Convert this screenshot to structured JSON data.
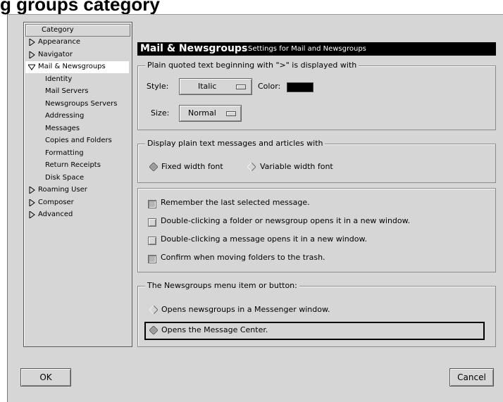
{
  "banner": {
    "text": "g                                                     groups category"
  },
  "tree": {
    "header": "Category",
    "items": [
      {
        "label": "Appearance",
        "level": 0,
        "expanded": false,
        "selected": false
      },
      {
        "label": "Navigator",
        "level": 0,
        "expanded": false,
        "selected": false
      },
      {
        "label": "Mail & Newsgroups",
        "level": 0,
        "expanded": true,
        "selected": true
      },
      {
        "label": "Identity",
        "level": 1,
        "selected": false
      },
      {
        "label": "Mail Servers",
        "level": 1,
        "selected": false
      },
      {
        "label": "Newsgroups Servers",
        "level": 1,
        "selected": false
      },
      {
        "label": "Addressing",
        "level": 1,
        "selected": false
      },
      {
        "label": "Messages",
        "level": 1,
        "selected": false
      },
      {
        "label": "Copies and Folders",
        "level": 1,
        "selected": false
      },
      {
        "label": "Formatting",
        "level": 1,
        "selected": false
      },
      {
        "label": "Return Receipts",
        "level": 1,
        "selected": false
      },
      {
        "label": "Disk Space",
        "level": 1,
        "selected": false
      },
      {
        "label": "Roaming User",
        "level": 0,
        "expanded": false,
        "selected": false
      },
      {
        "label": "Composer",
        "level": 0,
        "expanded": false,
        "selected": false
      },
      {
        "label": "Advanced",
        "level": 0,
        "expanded": false,
        "selected": false
      }
    ]
  },
  "section": {
    "title": "Mail & Newsgroups",
    "subtitle": "Settings for Mail and Newsgroups"
  },
  "quoted": {
    "legend": "Plain quoted text beginning with \">\" is displayed with",
    "style_label": "Style:",
    "style_value": "Italic",
    "color_label": "Color:",
    "color_value": "#000000",
    "size_label": "Size:",
    "size_value": "Normal"
  },
  "display": {
    "legend": "Display plain text messages and articles with",
    "options": [
      {
        "label": "Fixed width font",
        "selected": true
      },
      {
        "label": "Variable width font",
        "selected": false
      }
    ]
  },
  "checks": [
    {
      "label": "Remember the last selected message.",
      "checked": true
    },
    {
      "label": "Double-clicking a folder or newsgroup opens it in a new window.",
      "checked": false
    },
    {
      "label": "Double-clicking a message opens it in a new window.",
      "checked": false
    },
    {
      "label": "Confirm when moving folders to the trash.",
      "checked": true
    }
  ],
  "newsgroups": {
    "legend": "The Newsgroups menu item or button:",
    "options": [
      {
        "label": "Opens newsgroups in a Messenger window.",
        "selected": false
      },
      {
        "label": "Opens the Message Center.",
        "selected": true
      }
    ]
  },
  "buttons": {
    "ok": "OK",
    "cancel": "Cancel"
  },
  "colors": {
    "dialog_bg": "#d6d6d6",
    "title_bg": "#000000",
    "selection_bg": "#ffffff"
  }
}
